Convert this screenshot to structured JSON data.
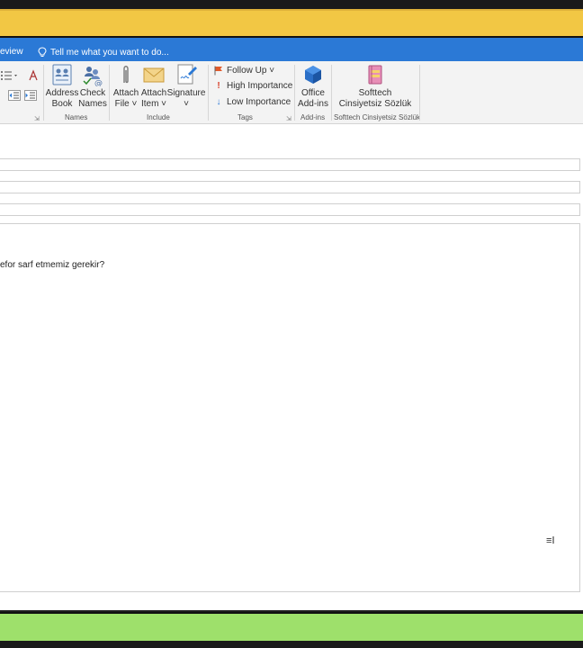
{
  "tabs": {
    "review": "eview",
    "tell_me": "Tell me what you want to do..."
  },
  "ribbon": {
    "names_group": {
      "label": "Names",
      "address_book": [
        "Address",
        "Book"
      ],
      "check_names": [
        "Check",
        "Names"
      ]
    },
    "include_group": {
      "label": "Include",
      "attach_file": [
        "Attach",
        "File ˅"
      ],
      "attach_item": [
        "Attach",
        "Item ˅"
      ],
      "signature": [
        "Signature",
        "˅"
      ]
    },
    "tags_group": {
      "label": "Tags",
      "follow_up": "Follow Up ˅",
      "high_importance": "High Importance",
      "low_importance": "Low Importance"
    },
    "addins_group": {
      "label": "Add-ins",
      "office_addins": [
        "Office",
        "Add-ins"
      ]
    },
    "softtech_group": {
      "label": "Softtech Cinsiyetsiz Sözlük",
      "button": [
        "Softtech",
        "Cinsiyetsiz Sözlük"
      ]
    }
  },
  "compose": {
    "body_text": "efor sarf etmemiz gerekir?"
  },
  "colors": {
    "tabbar": "#2b79d6",
    "yellow": "#f2c744",
    "green": "#9ee06b",
    "follow_up_flag": "#e05a2b",
    "high_importance": "#d8402a",
    "low_importance": "#2b79d6"
  }
}
